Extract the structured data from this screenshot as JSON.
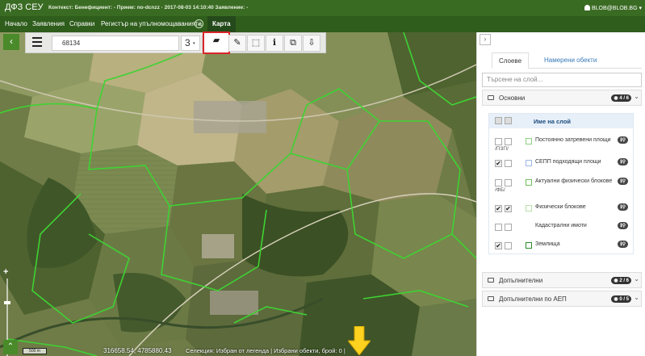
{
  "header": {
    "app_name": "ДФЗ СЕУ",
    "context": "Контекст: Бенефициент: - Прием: no-dcnzz · 2017-08-03 14:10:40 Заявление: -",
    "user": "BLOB@BLOB.BG"
  },
  "nav": {
    "items": [
      "Начало",
      "Заявления",
      "Справки",
      "Регистър на упълномощаванията"
    ],
    "active": "Карта"
  },
  "map": {
    "back_icon": "‹",
    "search_value": "68134",
    "zoom_level": "3",
    "scale_label": "500 m",
    "coordinates": "316658.54, 4785880.43",
    "selection_text": "Селекция: Избран от легенда | Избрани обекти, брой: 0 |",
    "tools": [
      {
        "name": "search-icon",
        "glyph": "⚲"
      },
      {
        "name": "parcel-select-icon",
        "glyph": "▰"
      },
      {
        "name": "pencil-icon",
        "glyph": "✎"
      },
      {
        "name": "polygon-edit-icon",
        "glyph": "⬚"
      },
      {
        "name": "info-icon",
        "glyph": "ℹ"
      },
      {
        "name": "layers-copy-icon",
        "glyph": "⧉"
      },
      {
        "name": "download-icon",
        "glyph": "⇩"
      }
    ]
  },
  "panel": {
    "tabs": [
      "Слоеве",
      "Намерени обекти"
    ],
    "search_placeholder": "Търсене на слой...",
    "groups": [
      {
        "title": "Основни",
        "badge": "4 / 6"
      },
      {
        "title": "Допълнителни",
        "badge": "2 / 6"
      },
      {
        "title": "Допълнителни по АЕП",
        "badge": "0 / 5"
      }
    ],
    "table_header": "Име на слой",
    "layers": [
      {
        "name": "Постоянно затревени площи",
        "suffix": "/ПЗП/",
        "checked": false,
        "color": "#8ccf7e"
      },
      {
        "name": "СЕПП подходящи площи",
        "suffix": "",
        "checked": true,
        "color": "#9fb7e6"
      },
      {
        "name": "Актуални физически блокове",
        "suffix": "/ФБ/",
        "checked": false,
        "color": "#6cbf5a"
      },
      {
        "name": "Физически блокове",
        "suffix": "",
        "checked": true,
        "color": "#b7dfa8"
      },
      {
        "name": "Кадастрални имоти",
        "suffix": "",
        "checked": false,
        "color": "#d3d3d3"
      },
      {
        "name": "Землища",
        "suffix": "",
        "checked": true,
        "color": "#2e8b2e"
      }
    ]
  }
}
